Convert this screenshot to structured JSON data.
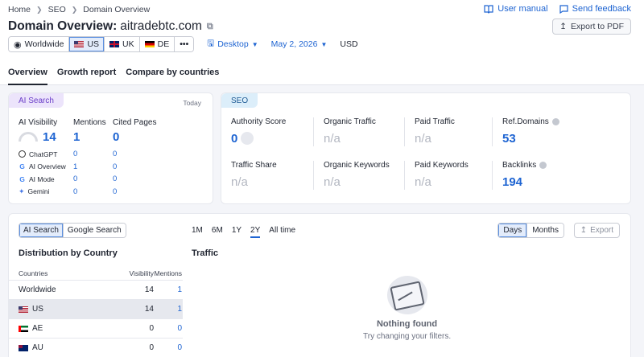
{
  "breadcrumb": [
    "Home",
    "SEO",
    "Domain Overview"
  ],
  "top_links": {
    "user_manual": "User manual",
    "send_feedback": "Send feedback"
  },
  "title": {
    "label": "Domain Overview:",
    "domain": "aitradebtc.com"
  },
  "export_pdf": "Export to PDF",
  "filters": {
    "databases": [
      {
        "label": "Worldwide",
        "flag": "globe"
      },
      {
        "label": "US",
        "flag": "us",
        "active": true
      },
      {
        "label": "UK",
        "flag": "uk"
      },
      {
        "label": "DE",
        "flag": "de"
      },
      {
        "label": "•••"
      }
    ],
    "device": "Desktop",
    "date": "May 2, 2026",
    "currency": "USD"
  },
  "tabs": [
    "Overview",
    "Growth report",
    "Compare by countries"
  ],
  "ai_search": {
    "badge": "AI Search",
    "date_label": "Today",
    "headers": {
      "visibility": "AI Visibility",
      "mentions": "Mentions",
      "cited": "Cited Pages"
    },
    "totals": {
      "visibility": "14",
      "mentions": "1",
      "cited": "0"
    },
    "platforms": [
      {
        "name": "ChatGPT",
        "icon": "chatgpt-icon",
        "mentions": "0",
        "cited": "0"
      },
      {
        "name": "AI Overview",
        "icon": "google-icon",
        "mentions": "1",
        "cited": "0"
      },
      {
        "name": "AI Mode",
        "icon": "google-icon",
        "mentions": "0",
        "cited": "0"
      },
      {
        "name": "Gemini",
        "icon": "gemini-icon",
        "mentions": "0",
        "cited": "0"
      }
    ]
  },
  "seo": {
    "badge": "SEO",
    "authority_score": {
      "label": "Authority Score",
      "value": "0"
    },
    "organic_traffic": {
      "label": "Organic Traffic",
      "value": "n/a"
    },
    "paid_traffic": {
      "label": "Paid Traffic",
      "value": "n/a"
    },
    "ref_domains": {
      "label": "Ref.Domains",
      "value": "53"
    },
    "traffic_share": {
      "label": "Traffic Share",
      "value": "n/a"
    },
    "organic_keywords": {
      "label": "Organic Keywords",
      "value": "n/a"
    },
    "paid_keywords": {
      "label": "Paid Keywords",
      "value": "n/a"
    },
    "backlinks": {
      "label": "Backlinks",
      "value": "194"
    }
  },
  "bottom": {
    "source_tabs": [
      "AI Search",
      "Google Search"
    ],
    "periods": [
      "1M",
      "6M",
      "1Y",
      "2Y",
      "All time"
    ],
    "active_period": "2Y",
    "granularity": [
      "Days",
      "Months"
    ],
    "export": "Export",
    "distribution_title": "Distribution by Country",
    "traffic_title": "Traffic",
    "table": {
      "headers": {
        "country": "Countries",
        "visibility": "Visibility",
        "mentions": "Mentions"
      },
      "rows": [
        {
          "country": "Worldwide",
          "flag": "",
          "visibility": "14",
          "mentions": "1"
        },
        {
          "country": "US",
          "flag": "us",
          "visibility": "14",
          "mentions": "1",
          "selected": true
        },
        {
          "country": "AE",
          "flag": "ae",
          "visibility": "0",
          "mentions": "0"
        },
        {
          "country": "AU",
          "flag": "au",
          "visibility": "0",
          "mentions": "0"
        }
      ]
    },
    "empty": {
      "title": "Nothing found",
      "subtitle": "Try changing your filters."
    }
  },
  "colors": {
    "accent": "#1e64d2",
    "ai_badge": "#ece4fb",
    "seo_badge": "#dceefa"
  }
}
